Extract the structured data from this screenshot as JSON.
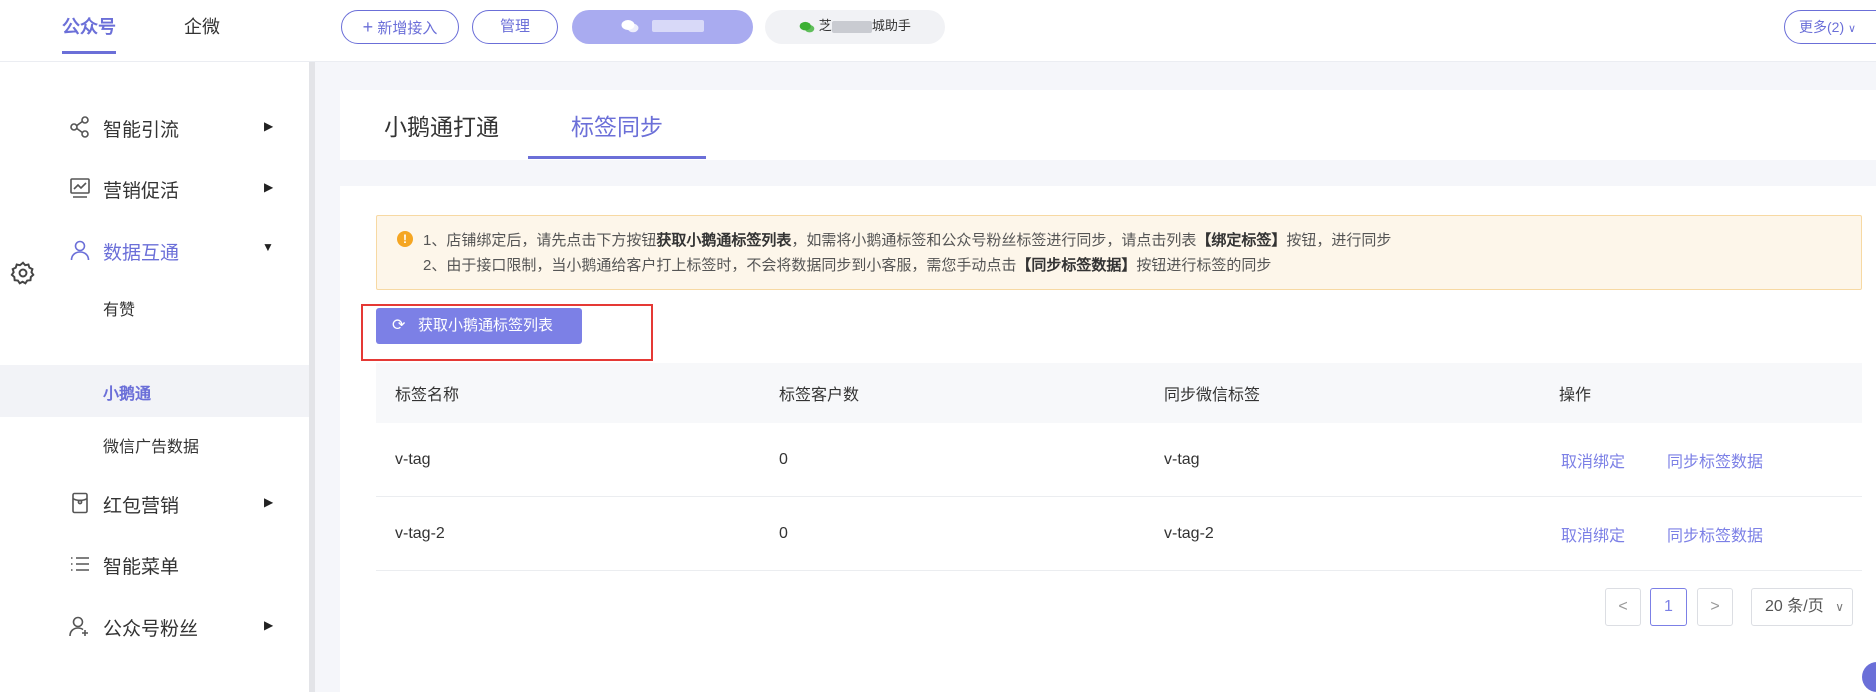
{
  "colors": {
    "accent": "#6b6fd8",
    "button": "#7c80e6",
    "highlight_box": "#e53935",
    "notice_bg": "#fdf6ea"
  },
  "topbar": {
    "tabs": [
      "公众号",
      "企微"
    ],
    "add_button": "新增接入",
    "manage_button": "管理",
    "account2_prefix": "芝",
    "account2_suffix": "城助手",
    "more_button": "更多(2)"
  },
  "sidebar": {
    "items": [
      {
        "label": "智能引流",
        "icon": "share-icon"
      },
      {
        "label": "营销促活",
        "icon": "chart-icon"
      },
      {
        "label": "数据互通",
        "icon": "user-icon"
      },
      {
        "label": "红包营销",
        "icon": "red-packet-icon"
      },
      {
        "label": "智能菜单",
        "icon": "list-icon"
      },
      {
        "label": "公众号粉丝",
        "icon": "fans-icon"
      }
    ],
    "sub_items": [
      "有赞",
      "小鹅通",
      "微信广告数据"
    ]
  },
  "content_tabs": [
    "小鹅通打通",
    "标签同步"
  ],
  "notice": {
    "line1_a": "1、店铺绑定后，请先点击下方按钮",
    "line1_b": "获取小鹅通标签列表",
    "line1_c": "，如需将小鹅通标签和公众号粉丝标签进行同步，请点击列表",
    "line1_d": "【绑定标签】",
    "line1_e": "按钮，进行同步",
    "line2_a": "2、由于接口限制，当小鹅通给客户打上标签时，不会将数据同步到小客服，需您手动点击",
    "line2_b": "【同步标签数据】",
    "line2_c": "按钮进行标签的同步"
  },
  "fetch_button": "获取小鹅通标签列表",
  "table": {
    "headers": [
      "标签名称",
      "标签客户数",
      "同步微信标签",
      "操作"
    ],
    "rows": [
      {
        "name": "v-tag",
        "count": "0",
        "wx_tag": "v-tag",
        "action1": "取消绑定",
        "action2": "同步标签数据"
      },
      {
        "name": "v-tag-2",
        "count": "0",
        "wx_tag": "v-tag-2",
        "action1": "取消绑定",
        "action2": "同步标签数据"
      }
    ]
  },
  "pagination": {
    "prev": "<",
    "current": "1",
    "next": ">",
    "page_size": "20 条/页"
  }
}
